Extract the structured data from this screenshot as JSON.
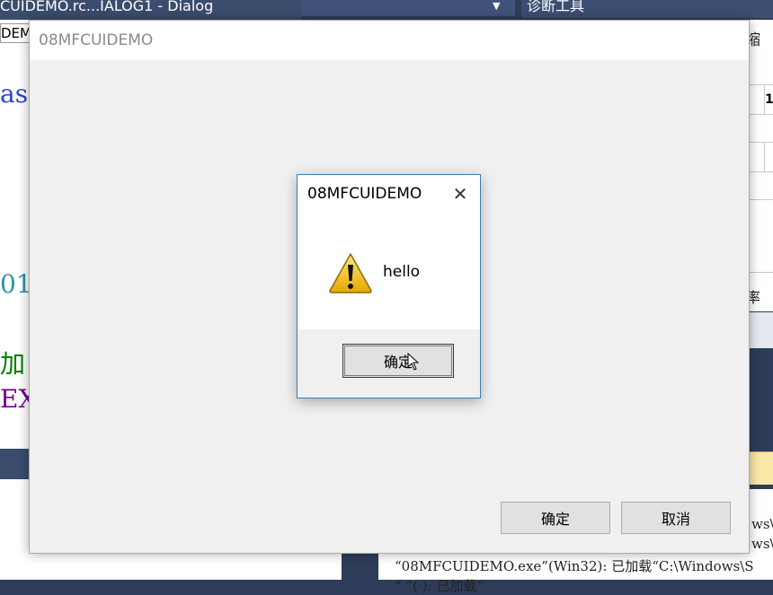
{
  "ide": {
    "doc_tab": "CUIDEMO.rc...IALOG1 - Dialog",
    "diag_title": "诊断工具",
    "editor_combo": "DEM",
    "code_fragments": [
      "as",
      "01",
      "加",
      "EXT"
    ],
    "right_text_1": "、缩",
    "right_text_2": "率",
    "right_cells": [
      "1",
      "",
      "",
      ""
    ],
    "output_lines": [
      "ws\\S",
      "ws\\S",
      "“08MFCUIDEMO.exe”(Win32): 已加载“C:\\Windows\\S",
      "“                 ”(      ): 已加载“       "
    ]
  },
  "main_dialog": {
    "title": "08MFCUIDEMO",
    "ok_label": "确定",
    "cancel_label": "取消"
  },
  "message_box": {
    "title": "08MFCUIDEMO",
    "close_glyph": "✕",
    "text": "hello",
    "ok_label": "确定",
    "icon": "warning-icon"
  },
  "colors": {
    "accent_border": "#3c7fb1",
    "ide_dark": "#2e3d5a",
    "code_blue": "#2a45c8",
    "code_teal": "#2b91af",
    "code_green": "#008000",
    "code_purple": "#6f008a"
  }
}
